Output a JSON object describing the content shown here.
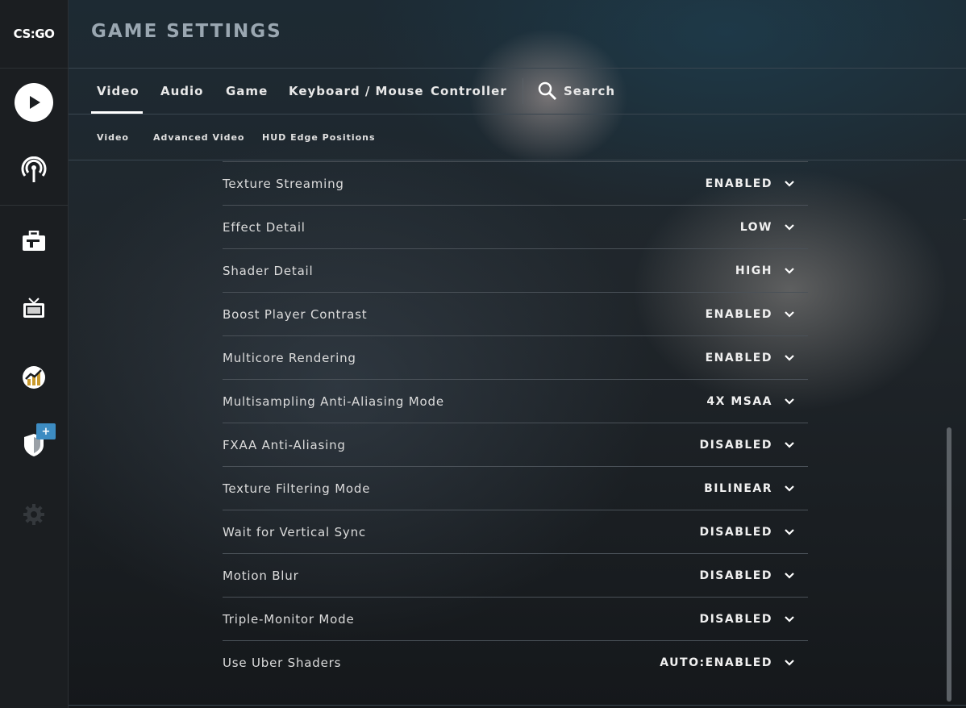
{
  "logo": {
    "text": "CS:GO"
  },
  "header": {
    "title": "GAME SETTINGS"
  },
  "sidebar": {
    "icons": [
      "play-icon",
      "broadcast-icon",
      "briefcase-icon",
      "tv-icon",
      "stats-icon",
      "shield-icon",
      "gear-icon"
    ],
    "badge": "+"
  },
  "tabs": [
    {
      "label": "Video",
      "active": true
    },
    {
      "label": "Audio"
    },
    {
      "label": "Game"
    },
    {
      "label": "Keyboard / Mouse"
    },
    {
      "label": "Controller"
    }
  ],
  "search": {
    "label": "Search"
  },
  "subtabs": [
    {
      "label": "Video"
    },
    {
      "label": "Advanced Video"
    },
    {
      "label": "HUD Edge Positions"
    }
  ],
  "settings": [
    {
      "label": "Texture Streaming",
      "value": "ENABLED"
    },
    {
      "label": "Effect Detail",
      "value": "LOW"
    },
    {
      "label": "Shader Detail",
      "value": "HIGH"
    },
    {
      "label": "Boost Player Contrast",
      "value": "ENABLED"
    },
    {
      "label": "Multicore Rendering",
      "value": "ENABLED"
    },
    {
      "label": "Multisampling Anti-Aliasing Mode",
      "value": "4X MSAA"
    },
    {
      "label": "FXAA Anti-Aliasing",
      "value": "DISABLED"
    },
    {
      "label": "Texture Filtering Mode",
      "value": "BILINEAR"
    },
    {
      "label": "Wait for Vertical Sync",
      "value": "DISABLED"
    },
    {
      "label": "Motion Blur",
      "value": "DISABLED"
    },
    {
      "label": "Triple-Monitor Mode",
      "value": "DISABLED"
    },
    {
      "label": "Use Uber Shaders",
      "value": "AUTO:ENABLED"
    }
  ]
}
